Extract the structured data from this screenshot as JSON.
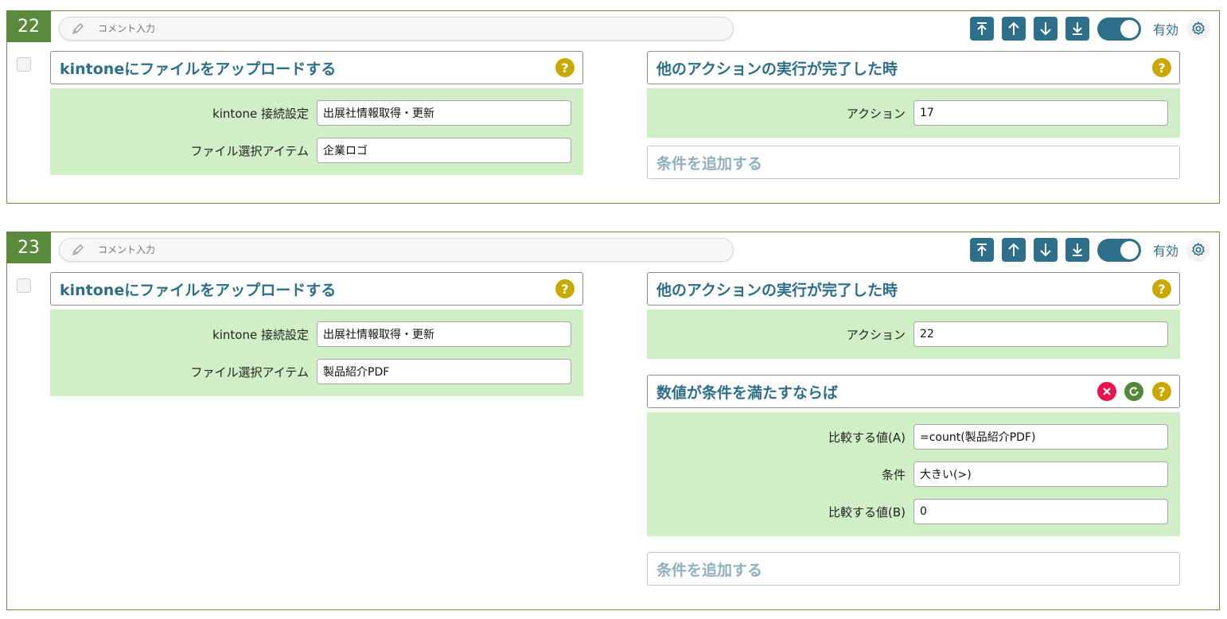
{
  "cards": [
    {
      "number": "22",
      "comment_placeholder": "コメント入力",
      "enabled_label": "有効",
      "action": {
        "title": "kintoneにファイルをアップロードする",
        "fields": [
          {
            "label": "kintone 接続設定",
            "value": "出展社情報取得・更新"
          },
          {
            "label": "ファイル選択アイテム",
            "value": "企業ロゴ"
          }
        ]
      },
      "trigger": {
        "title": "他のアクションの実行が完了した時",
        "fields": [
          {
            "label": "アクション",
            "value": "17"
          }
        ]
      },
      "add_condition_label": "条件を追加する"
    },
    {
      "number": "23",
      "comment_placeholder": "コメント入力",
      "enabled_label": "有効",
      "action": {
        "title": "kintoneにファイルをアップロードする",
        "fields": [
          {
            "label": "kintone 接続設定",
            "value": "出展社情報取得・更新"
          },
          {
            "label": "ファイル選択アイテム",
            "value": "製品紹介PDF"
          }
        ]
      },
      "trigger": {
        "title": "他のアクションの実行が完了した時",
        "fields": [
          {
            "label": "アクション",
            "value": "22"
          }
        ]
      },
      "condition": {
        "title": "数値が条件を満たすならば",
        "fields": [
          {
            "label": "比較する値(A)",
            "value": "=count(製品紹介PDF)"
          },
          {
            "label": "条件",
            "value": "大きい(>)"
          },
          {
            "label": "比較する値(B)",
            "value": "0"
          }
        ]
      },
      "add_condition_label": "条件を追加する"
    }
  ],
  "colors": {
    "accent": "#2d6f8a",
    "number_bg": "#5a8a3c",
    "panel_green": "#d1efc6",
    "help": "#c9a800",
    "delete": "#e8154f",
    "refresh": "#4f8a3a"
  },
  "icons": [
    "pencil-icon",
    "move-top-icon",
    "move-up-icon",
    "move-down-icon",
    "move-bottom-icon",
    "gear-icon",
    "help-icon",
    "close-icon",
    "refresh-icon"
  ]
}
